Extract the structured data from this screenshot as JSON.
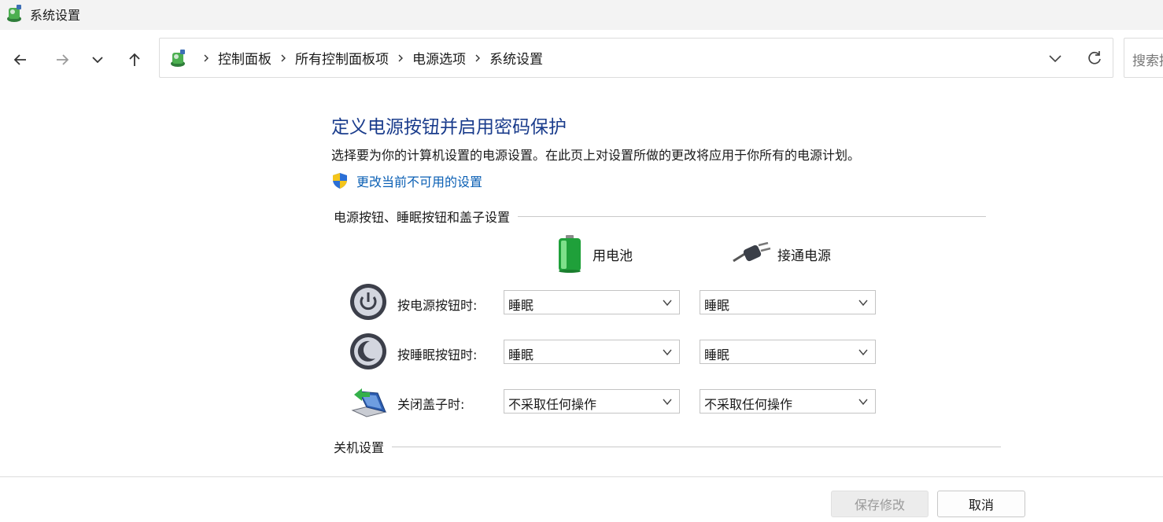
{
  "window": {
    "title": "系统设置"
  },
  "navigation": {
    "breadcrumbs": [
      "控制面板",
      "所有控制面板项",
      "电源选项",
      "系统设置"
    ],
    "search_placeholder": "搜索控制面板"
  },
  "page": {
    "heading": "定义电源按钮并启用密码保护",
    "description": "选择要为你的计算机设置的电源设置。在此页上对设置所做的更改将应用于你所有的电源计划。",
    "change_link": "更改当前不可用的设置"
  },
  "button_settings": {
    "section_title": "电源按钮、睡眠按钮和盖子设置",
    "columns": [
      "用电池",
      "接通电源"
    ],
    "rows": [
      {
        "label": "按电源按钮时:",
        "battery": "睡眠",
        "plugged": "睡眠"
      },
      {
        "label": "按睡眠按钮时:",
        "battery": "睡眠",
        "plugged": "睡眠"
      },
      {
        "label": "关闭盖子时:",
        "battery": "不采取任何操作",
        "plugged": "不采取任何操作"
      }
    ]
  },
  "shutdown_settings": {
    "section_title": "关机设置"
  },
  "footer": {
    "save_label": "保存修改",
    "cancel_label": "取消"
  },
  "colors": {
    "heading": "#1a3c8c",
    "link": "#0a5fb4",
    "disabled_text": "#9a9a9a"
  }
}
